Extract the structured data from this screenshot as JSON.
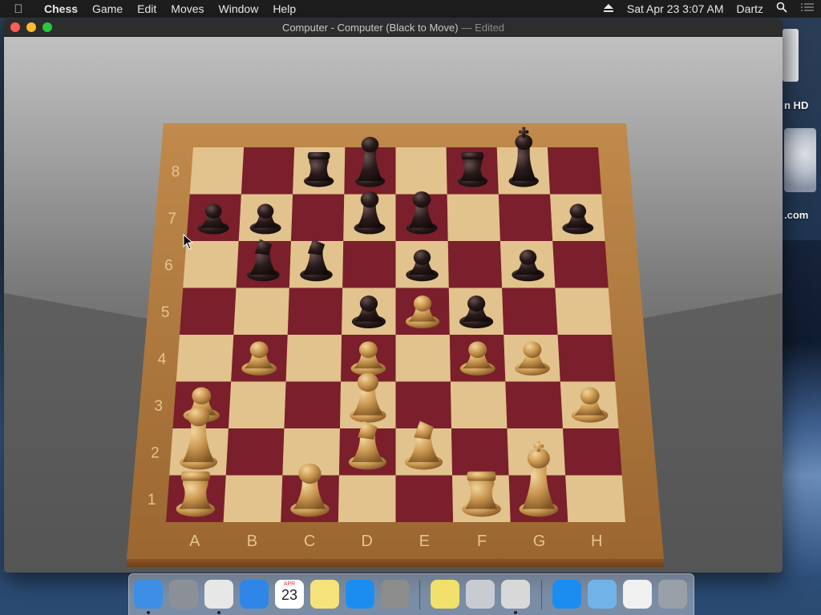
{
  "menubar": {
    "app_name": "Chess",
    "items": [
      "Game",
      "Edit",
      "Moves",
      "Window",
      "Help"
    ],
    "datetime": "Sat Apr 23  3:07 AM",
    "user": "Dartz"
  },
  "window": {
    "title": "Computer - Computer   (Black to Move)",
    "edited": "— Edited"
  },
  "board": {
    "files": [
      "A",
      "B",
      "C",
      "D",
      "E",
      "F",
      "G",
      "H"
    ],
    "ranks": [
      "8",
      "7",
      "6",
      "5",
      "4",
      "3",
      "2",
      "1"
    ],
    "light_square": "#e2c38d",
    "dark_square": "#7a1f2b",
    "frame_color": "#a9743c",
    "pieces": [
      {
        "sq": "c8",
        "type": "rook",
        "color": "black"
      },
      {
        "sq": "d8",
        "type": "queen",
        "color": "black"
      },
      {
        "sq": "f8",
        "type": "rook",
        "color": "black"
      },
      {
        "sq": "g8",
        "type": "king",
        "color": "black"
      },
      {
        "sq": "a7",
        "type": "pawn",
        "color": "black"
      },
      {
        "sq": "b7",
        "type": "pawn",
        "color": "black"
      },
      {
        "sq": "d7",
        "type": "bishop",
        "color": "black"
      },
      {
        "sq": "e7",
        "type": "bishop",
        "color": "black"
      },
      {
        "sq": "h7",
        "type": "pawn",
        "color": "black"
      },
      {
        "sq": "b6",
        "type": "knight",
        "color": "black"
      },
      {
        "sq": "c6",
        "type": "knight",
        "color": "black"
      },
      {
        "sq": "e6",
        "type": "pawn",
        "color": "black"
      },
      {
        "sq": "g6",
        "type": "pawn",
        "color": "black"
      },
      {
        "sq": "d5",
        "type": "pawn",
        "color": "black"
      },
      {
        "sq": "f5",
        "type": "pawn",
        "color": "black"
      },
      {
        "sq": "e5",
        "type": "pawn",
        "color": "white"
      },
      {
        "sq": "b4",
        "type": "pawn",
        "color": "white"
      },
      {
        "sq": "d4",
        "type": "pawn",
        "color": "white"
      },
      {
        "sq": "f4",
        "type": "pawn",
        "color": "white"
      },
      {
        "sq": "g4",
        "type": "pawn",
        "color": "white"
      },
      {
        "sq": "a3",
        "type": "pawn",
        "color": "white"
      },
      {
        "sq": "d3",
        "type": "bishop",
        "color": "white"
      },
      {
        "sq": "h3",
        "type": "pawn",
        "color": "white"
      },
      {
        "sq": "a2",
        "type": "queen",
        "color": "white"
      },
      {
        "sq": "d2",
        "type": "knight",
        "color": "white"
      },
      {
        "sq": "e2",
        "type": "knight",
        "color": "white"
      },
      {
        "sq": "a1",
        "type": "rook",
        "color": "white"
      },
      {
        "sq": "c1",
        "type": "bishop",
        "color": "white"
      },
      {
        "sq": "f1",
        "type": "rook",
        "color": "white"
      },
      {
        "sq": "g1",
        "type": "king",
        "color": "white"
      }
    ]
  },
  "desktop": {
    "drive_label": "n HD",
    "web_label": ".com"
  },
  "dock": {
    "items": [
      {
        "name": "finder-icon",
        "color": "#3d8fe6",
        "running": true
      },
      {
        "name": "launchpad-icon",
        "color": "#8a8f98",
        "running": false
      },
      {
        "name": "chrome-icon",
        "color": "#e7e7e7",
        "running": true
      },
      {
        "name": "safari-icon",
        "color": "#2f86e6",
        "running": false
      },
      {
        "name": "calendar-icon",
        "color": "#ffffff",
        "running": false,
        "label": "23",
        "month": "APR"
      },
      {
        "name": "notes-icon",
        "color": "#f6e27a",
        "running": false
      },
      {
        "name": "app-store-icon",
        "color": "#1c8df0",
        "running": false
      },
      {
        "name": "system-preferences-icon",
        "color": "#8c8c8c",
        "running": false
      },
      {
        "name": "stickies-icon",
        "color": "#f1e06a",
        "running": false
      },
      {
        "name": "instruments-icon",
        "color": "#c8ccd2",
        "running": false
      },
      {
        "name": "chess-icon",
        "color": "#d8d8d8",
        "running": true
      },
      {
        "name": "app-store-folder-icon",
        "color": "#1c8df0",
        "running": false
      },
      {
        "name": "folder-icon",
        "color": "#6fb3e8",
        "running": false
      },
      {
        "name": "documents-icon",
        "color": "#f0f0f0",
        "running": false
      },
      {
        "name": "trash-icon",
        "color": "#9aa0a8",
        "running": false
      }
    ]
  }
}
